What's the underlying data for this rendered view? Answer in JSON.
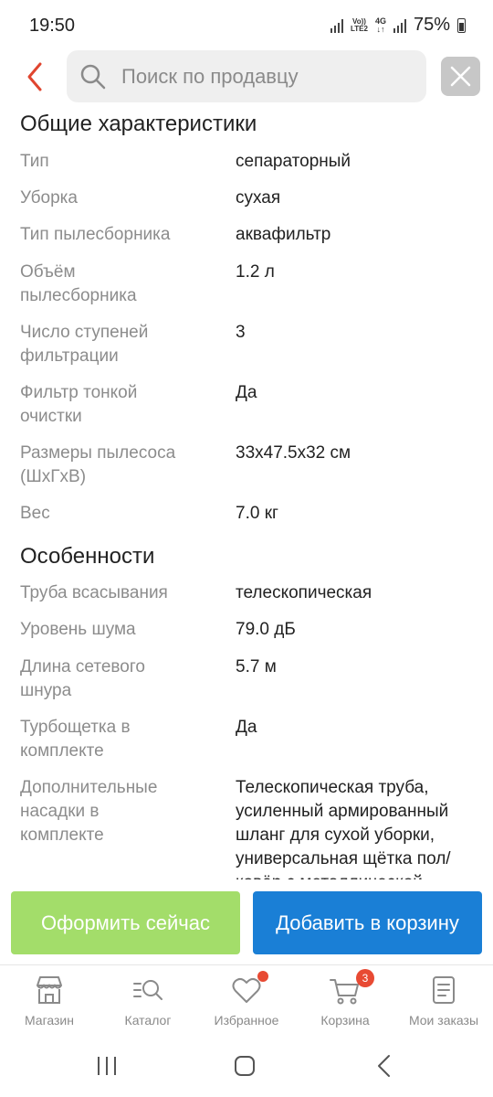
{
  "status": {
    "time": "19:50",
    "volte_label": "Vo))\nLTE2",
    "network": "4G",
    "battery": "75%"
  },
  "search": {
    "placeholder": "Поиск по продавцу"
  },
  "sections": [
    {
      "title": "Общие характеристики",
      "rows": [
        {
          "label": "Тип",
          "value": "сепараторный"
        },
        {
          "label": "Уборка",
          "value": "сухая"
        },
        {
          "label": "Тип пылесборника",
          "value": "аквафильтр"
        },
        {
          "label": "Объём пылесборника",
          "value": "1.2 л"
        },
        {
          "label": "Число ступеней фильтрации",
          "value": "3"
        },
        {
          "label": "Фильтр тонкой очистки",
          "value": "Да"
        },
        {
          "label": "Размеры пылесоса (ШхГхВ)",
          "value": "33x47.5x32 см"
        },
        {
          "label": "Вес",
          "value": "7.0 кг"
        }
      ]
    },
    {
      "title": "Особенности",
      "rows": [
        {
          "label": "Труба всасывания",
          "value": "телескопическая"
        },
        {
          "label": "Уровень шума",
          "value": "79.0 дБ"
        },
        {
          "label": "Длина сетевого шнура",
          "value": "5.7 м"
        },
        {
          "label": "Турбощетка в комплекте",
          "value": "Да"
        },
        {
          "label": "Дополнительные насадки в комплекте",
          "value": "Телескопическая труба, усиленный армированный шланг для сухой уборки, универсальная щётка пол/ковёр с металлической"
        }
      ]
    }
  ],
  "actions": {
    "buy_now": "Оформить сейчас",
    "add_to_cart": "Добавить в корзину"
  },
  "nav": {
    "items": [
      {
        "label": "Магазин",
        "icon": "store-icon"
      },
      {
        "label": "Каталог",
        "icon": "catalog-search-icon"
      },
      {
        "label": "Избранное",
        "icon": "heart-icon"
      },
      {
        "label": "Корзина",
        "icon": "cart-icon",
        "badge": "3"
      },
      {
        "label": "Мои заказы",
        "icon": "orders-icon"
      }
    ]
  },
  "colors": {
    "buy_now_bg": "#a3dd6a",
    "add_to_cart_bg": "#1a7fd6",
    "back_arrow": "#e0452f",
    "badge": "#e84a33"
  }
}
